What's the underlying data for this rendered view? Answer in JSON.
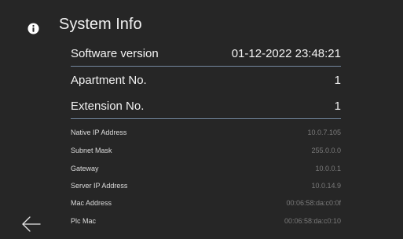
{
  "header": {
    "title": "System Info",
    "icon": "info-icon"
  },
  "main_rows": [
    {
      "label": "Software version",
      "value": "01-12-2022 23:48:21"
    },
    {
      "label": "Apartment No.",
      "value": "1"
    },
    {
      "label": "Extension No.",
      "value": "1"
    }
  ],
  "network_rows": [
    {
      "label": "Native IP Address",
      "value": "10.0.7.105"
    },
    {
      "label": "Subnet Mask",
      "value": "255.0.0.0"
    },
    {
      "label": "Gateway",
      "value": "10.0.0.1"
    },
    {
      "label": "Server IP Address",
      "value": "10.0.14.9"
    },
    {
      "label": "Mac Address",
      "value": "00:06:58:da:c0:0f"
    },
    {
      "label": "Plc Mac",
      "value": "00:06:58:da:c0:10"
    }
  ],
  "footer": {
    "back_icon": "back-arrow-icon"
  },
  "colors": {
    "background": "#262626",
    "divider": "#8faac8",
    "text": "#f2f2f2",
    "muted_value": "#7a7a7a"
  }
}
